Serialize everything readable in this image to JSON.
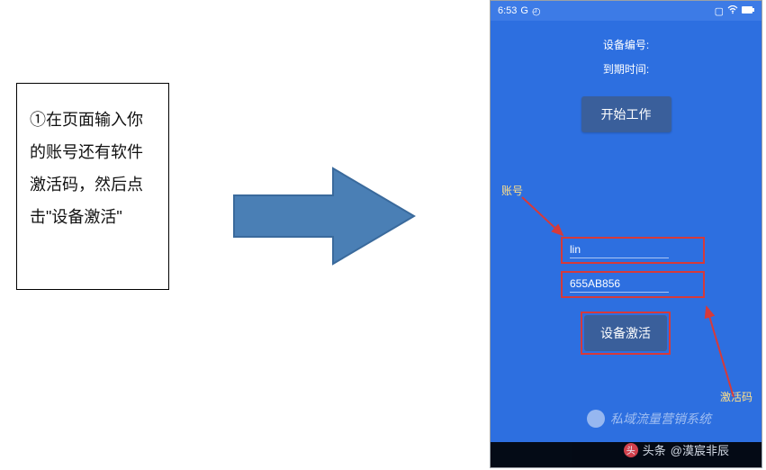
{
  "instruction": {
    "text": "①在页面输入你的账号还有软件激活码，然后点击\"设备激活\""
  },
  "phone": {
    "status": {
      "time": "6:53",
      "carrier": "G",
      "battery_icon": "battery-icon",
      "wifi_icon": "wifi-icon",
      "cast_icon": "cast-icon"
    },
    "device_id_label": "设备编号:",
    "expire_label": "到期时间:",
    "start_button": "开始工作",
    "annot_account": "账号",
    "annot_code": "激活码",
    "account_value": "lin",
    "code_value": "655AB856",
    "activate_button": "设备激活"
  },
  "watermarks": {
    "wechat": "私域流量营销系统",
    "toutiao_prefix": "头条",
    "toutiao_handle": "@漠宸非辰"
  }
}
